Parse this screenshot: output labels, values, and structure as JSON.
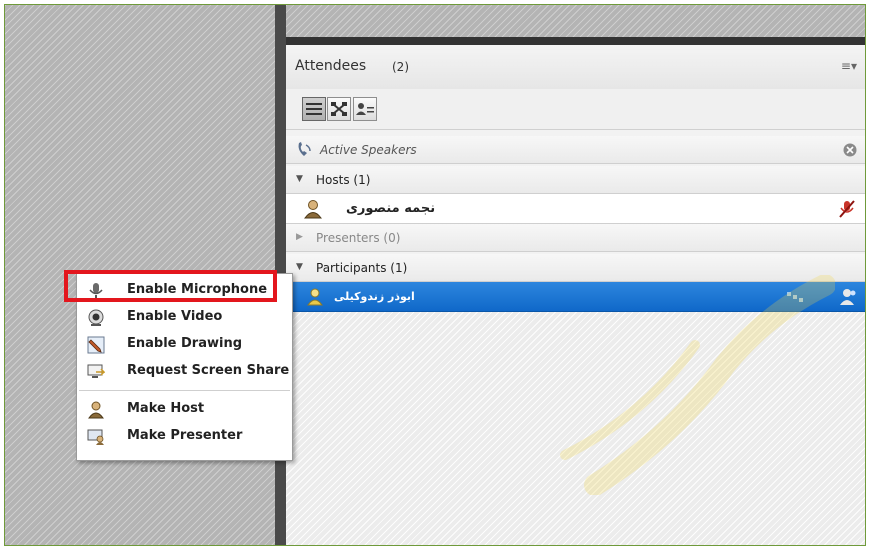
{
  "panel": {
    "title": "Attendees",
    "count": "(2)",
    "menu_icon": "≡▾"
  },
  "toolbar": {
    "buttons": [
      "list-view-icon",
      "grid-view-icon",
      "attendee-view-icon"
    ]
  },
  "active_speakers": {
    "label": "Active Speakers"
  },
  "hosts": {
    "label": "Hosts (1)",
    "member": {
      "name": "نجمه منصوری"
    }
  },
  "presenters": {
    "label": "Presenters (0)"
  },
  "participants": {
    "label": "Participants (1)",
    "member": {
      "name": "ابوذر زندوکیلی"
    }
  },
  "context_menu": {
    "items": [
      {
        "label": "Enable Microphone",
        "icon": "microphone-icon"
      },
      {
        "label": "Enable Video",
        "icon": "webcam-icon"
      },
      {
        "label": "Enable Drawing",
        "icon": "pencil-icon"
      },
      {
        "label": "Request Screen Share",
        "icon": "screen-share-icon"
      },
      {
        "label": "Make Host",
        "icon": "host-icon"
      },
      {
        "label": "Make Presenter",
        "icon": "presenter-icon"
      }
    ]
  },
  "colors": {
    "selection": "#1068c9",
    "highlight_border": "#e3161d",
    "frame_border": "#6f9a3a"
  }
}
